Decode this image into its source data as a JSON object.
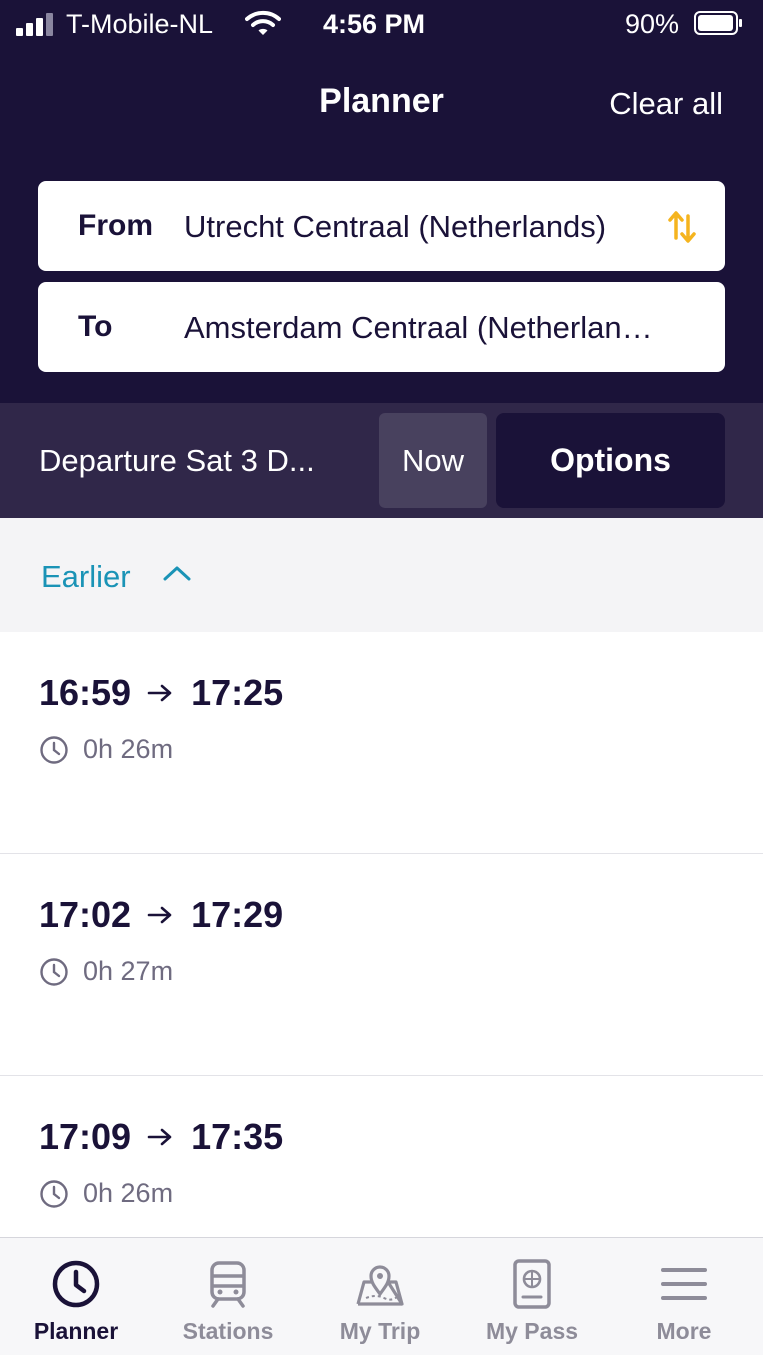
{
  "status_bar": {
    "carrier": "T-Mobile-NL",
    "time": "4:56 PM",
    "battery": "90%"
  },
  "header": {
    "title": "Planner",
    "clear_all": "Clear all"
  },
  "journey": {
    "from_label": "From",
    "from_value": "Utrecht Centraal (Netherlands)",
    "to_label": "To",
    "to_value": "Amsterdam Centraal (Netherlands)"
  },
  "departure": {
    "text": "Departure Sat 3 D...",
    "now_label": "Now",
    "options_label": "Options"
  },
  "earlier_label": "Earlier",
  "trips": [
    {
      "depart": "16:59",
      "arrive": "17:25",
      "duration": "0h 26m"
    },
    {
      "depart": "17:02",
      "arrive": "17:29",
      "duration": "0h 27m"
    },
    {
      "depart": "17:09",
      "arrive": "17:35",
      "duration": "0h 26m"
    }
  ],
  "tabs": [
    {
      "label": "Planner",
      "icon": "clock-icon",
      "active": true
    },
    {
      "label": "Stations",
      "icon": "train-icon",
      "active": false
    },
    {
      "label": "My Trip",
      "icon": "map-pin-icon",
      "active": false
    },
    {
      "label": "My Pass",
      "icon": "passport-icon",
      "active": false
    },
    {
      "label": "More",
      "icon": "menu-icon",
      "active": false
    }
  ],
  "colors": {
    "header_bg": "#1a1238",
    "departure_bar_bg": "#302749",
    "accent_link": "#1a93b6",
    "swap_icon": "#f5b41e"
  }
}
